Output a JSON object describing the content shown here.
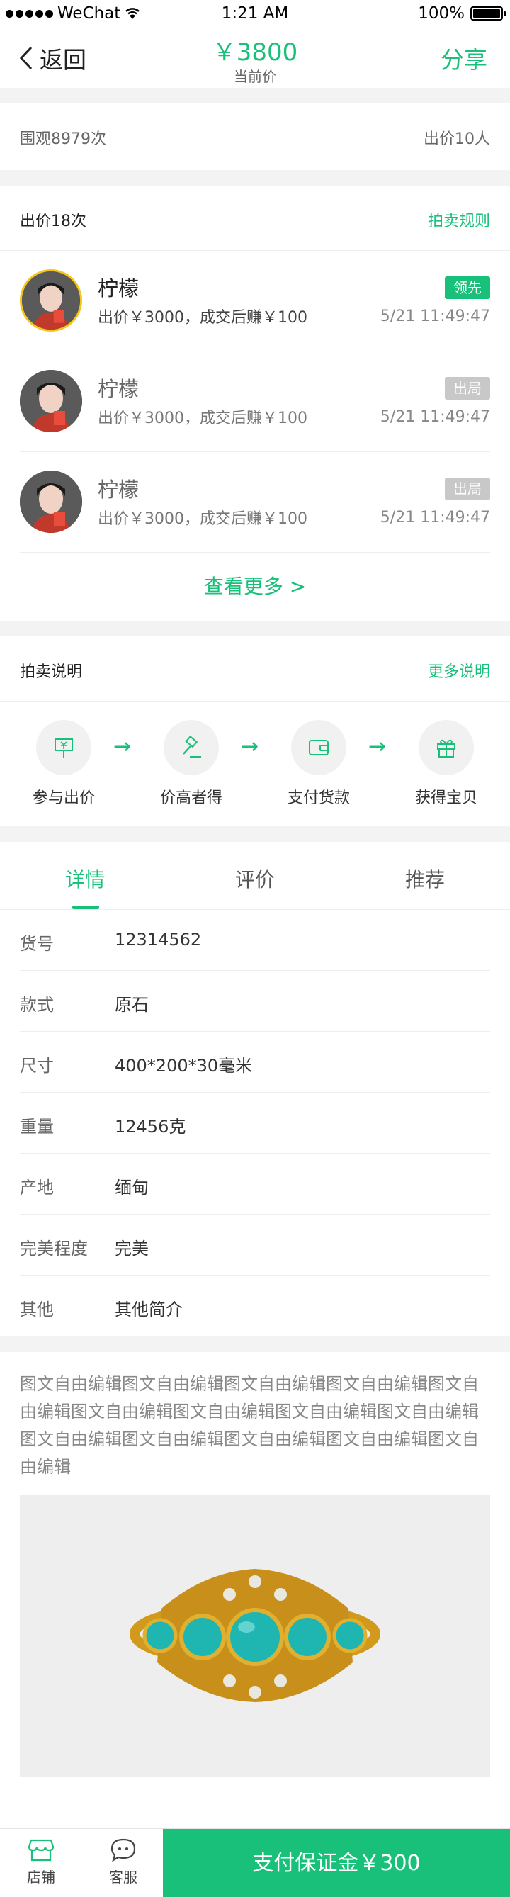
{
  "status_bar": {
    "carrier": "WeChat",
    "time": "1:21 AM",
    "battery": "100%"
  },
  "nav": {
    "back_label": "返回",
    "price": "￥3800",
    "price_label": "当前价",
    "share_label": "分享"
  },
  "stats": {
    "views": "围观8979次",
    "bidders": "出价10人"
  },
  "bids": {
    "header": "出价18次",
    "rules_link": "拍卖规则",
    "items": [
      {
        "name": "柠檬",
        "desc": "出价￥3000，成交后赚￥100",
        "badge": "领先",
        "time": "5/21 11:49:47"
      },
      {
        "name": "柠檬",
        "desc": "出价￥3000，成交后赚￥100",
        "badge": "出局",
        "time": "5/21 11:49:47"
      },
      {
        "name": "柠檬",
        "desc": "出价￥3000，成交后赚￥100",
        "badge": "出局",
        "time": "5/21 11:49:47"
      }
    ],
    "more_label": "查看更多 >"
  },
  "rules": {
    "title": "拍卖说明",
    "more_link": "更多说明",
    "steps": [
      {
        "label": "参与出价",
        "icon": "bid-sign-icon"
      },
      {
        "label": "价高者得",
        "icon": "gavel-icon"
      },
      {
        "label": "支付货款",
        "icon": "wallet-icon"
      },
      {
        "label": "获得宝贝",
        "icon": "gift-icon"
      }
    ],
    "arrow": "→"
  },
  "tabs": [
    "详情",
    "评价",
    "推荐"
  ],
  "specs": [
    {
      "key": "货号",
      "value": "12314562"
    },
    {
      "key": "款式",
      "value": "原石"
    },
    {
      "key": "尺寸",
      "value": "400*200*30毫米"
    },
    {
      "key": "重量",
      "value": "12456克"
    },
    {
      "key": "产地",
      "value": "缅甸"
    },
    {
      "key": "完美程度",
      "value": "完美"
    },
    {
      "key": "其他",
      "value": "其他简介"
    }
  ],
  "description": "图文自由编辑图文自由编辑图文自由编辑图文自由编辑图文自由编辑图文自由编辑图文自由编辑图文自由编辑图文自由编辑图文自由编辑图文自由编辑图文自由编辑图文自由编辑图文自由编辑",
  "bottom_bar": {
    "shop_label": "店铺",
    "service_label": "客服",
    "pay_label": "支付保证金￥300"
  },
  "colors": {
    "accent": "#19c07a",
    "badge_out": "#c8c8c8",
    "lead_ring": "#f5c518"
  }
}
